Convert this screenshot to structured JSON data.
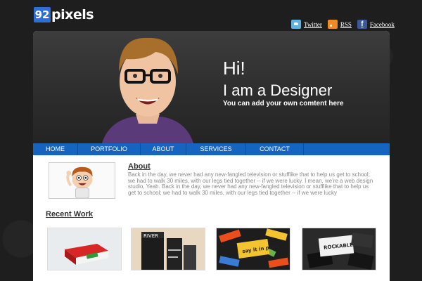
{
  "brand": {
    "badge": "92",
    "name": "pixels"
  },
  "social": [
    {
      "icon": "twitter-icon",
      "label": "Twitter"
    },
    {
      "icon": "rss-icon",
      "label": "RSS"
    },
    {
      "icon": "facebook-icon",
      "label": "Facebook",
      "glyph": "f"
    }
  ],
  "hero": {
    "title_line1": "Hi!",
    "title_line2": "I am a Designer",
    "subtitle": "You can add your own comtent here"
  },
  "nav": {
    "items": [
      "HOME",
      "PORTFOLIO",
      "ABOUT",
      "SERVICES",
      "CONTACT"
    ]
  },
  "about": {
    "title": "About",
    "body": "Back in the day, we never had any new-fangled television or stufflike that to help us get to school; we had to walk 30 miles, with our legs tied together -- if we were lucky. I mean, we're a web design studio, Yeah. Back in the day, we never had any new-fangled television or stufflike that to help us get to school; we had to walk 30 miles, with our legs tied together -- if we were lucky"
  },
  "recent_work": {
    "title": "Recent Work",
    "thumb_labels": [
      "RIVER",
      "say it in print",
      "ROCKABLE"
    ]
  },
  "colors": {
    "nav_bg": "#1565c0",
    "badge": "#2d6fd6",
    "page_bg": "#1e1e1e"
  }
}
